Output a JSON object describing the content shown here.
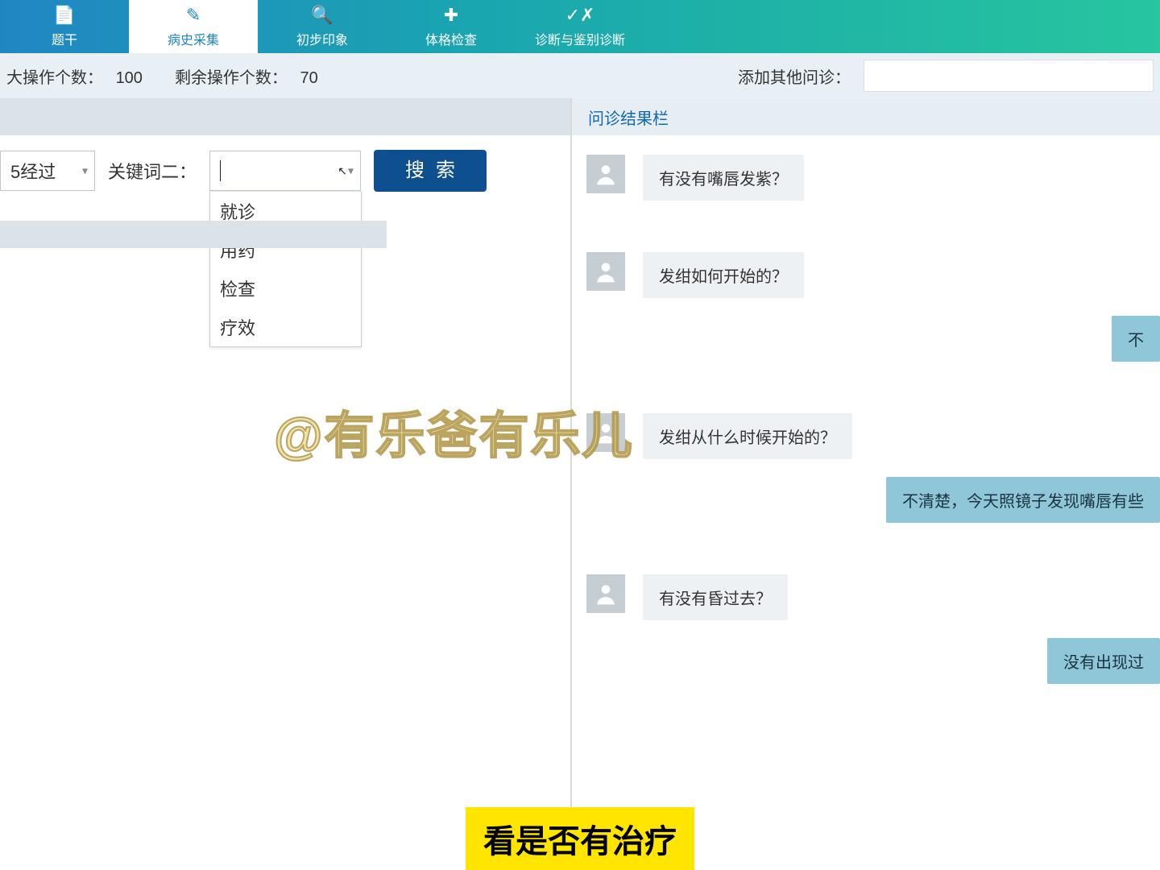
{
  "nav": {
    "tabs": [
      {
        "label": "题干"
      },
      {
        "label": "病史采集"
      },
      {
        "label": "初步印象"
      },
      {
        "label": "体格检查"
      },
      {
        "label": "诊断与鉴别诊断"
      }
    ]
  },
  "stats": {
    "max_label": "大操作个数：",
    "max_val": "100",
    "remain_label": "剩余操作个数：",
    "remain_val": "70",
    "add_label": "添加其他问诊：",
    "add_val": ""
  },
  "filter": {
    "kw1_value": "5经过",
    "kw2_label": "关键词二：",
    "kw2_value": "",
    "search_label": "搜索",
    "options": [
      {
        "label": "就诊"
      },
      {
        "label": "用药"
      },
      {
        "label": "检查"
      },
      {
        "label": "疗效"
      }
    ]
  },
  "result_title": "问诊结果栏",
  "chat": [
    {
      "side": "left",
      "text": "有没有嘴唇发紫？"
    },
    {
      "side": "left",
      "text": "发绀如何开始的？"
    },
    {
      "side": "right",
      "text": "不"
    },
    {
      "side": "left",
      "text": "发绀从什么时候开始的？"
    },
    {
      "side": "right",
      "text": "不清楚，今天照镜子发现嘴唇有些"
    },
    {
      "side": "left",
      "text": "有没有昏过去？"
    },
    {
      "side": "right",
      "text": "没有出现过"
    }
  ],
  "watermark": "@有乐爸有乐儿",
  "caption": "看是否有治疗"
}
